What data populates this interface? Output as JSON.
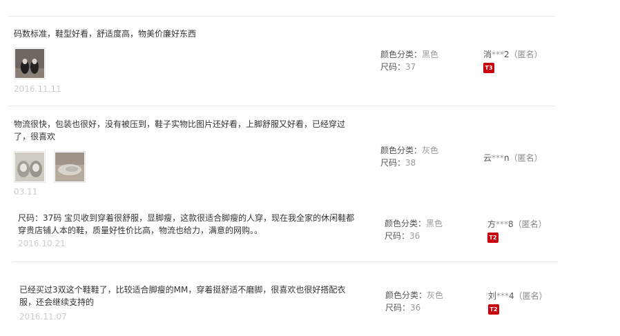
{
  "reviews": [
    {
      "text": "码数标准，鞋型好看，舒适度高，物美价廉好东西",
      "date": "2016.11.11",
      "color_label": "颜色分类：",
      "color_value": "黑色",
      "size_label": "尺码：",
      "size_value": "37",
      "user_prefix": "消",
      "user_mask": "***",
      "user_suffix": "2",
      "anonymous": "（匿名）",
      "badge": "T3"
    },
    {
      "text_line1": "物流很快，包装也很好，没有被压到，鞋子实物比图片还好看，上脚舒服又好看，已经穿过",
      "text_line2": "了，很喜欢",
      "date": "03.11",
      "color_label": "颜色分类：",
      "color_value": "灰色",
      "size_label": "尺码：",
      "size_value": "38",
      "user_prefix": "云",
      "user_mask": "***",
      "user_suffix": "n",
      "anonymous": "（匿名）"
    },
    {
      "text_line1": "尺码：37码 宝贝收到穿着很舒服，显脚瘦，这款很适合脚瘦的人穿，现在我全家的休闲鞋都",
      "text_line2": "穿贵店铺人本的鞋，质量好性价比高，物流也给力，满意的网购。。",
      "date": "2016.10.21",
      "color_label": "颜色分类：",
      "color_value": "黑色",
      "size_label": "尺码：",
      "size_value": "36",
      "user_prefix": "方",
      "user_mask": "***",
      "user_suffix": "8",
      "anonymous": "（匿名）",
      "badge": "T2"
    },
    {
      "text_line1": "已经买过3双这个鞋鞋了，比较适合脚瘦的MM，穿着挺舒适不磨脚，很喜欢也很好搭配衣",
      "text_line2": "服，还会继续支持的",
      "date": "2016.11.07",
      "color_label": "颜色分类：",
      "color_value": "灰色",
      "size_label": "尺码：",
      "size_value": "36",
      "user_prefix": "刘",
      "user_mask": "***",
      "user_suffix": "4",
      "anonymous": "（匿名）",
      "badge": "T2"
    }
  ],
  "colors": {
    "divider": "#e6e6e6",
    "date": "#cccccc",
    "badge": "#c7000b",
    "muted": "#999999"
  },
  "icons": {
    "photo_1": "shoe-photo-black",
    "photo_2": "shoe-photo-grey",
    "photo_3": "shoe-photo-grey-side",
    "badge": "rank-badge"
  }
}
